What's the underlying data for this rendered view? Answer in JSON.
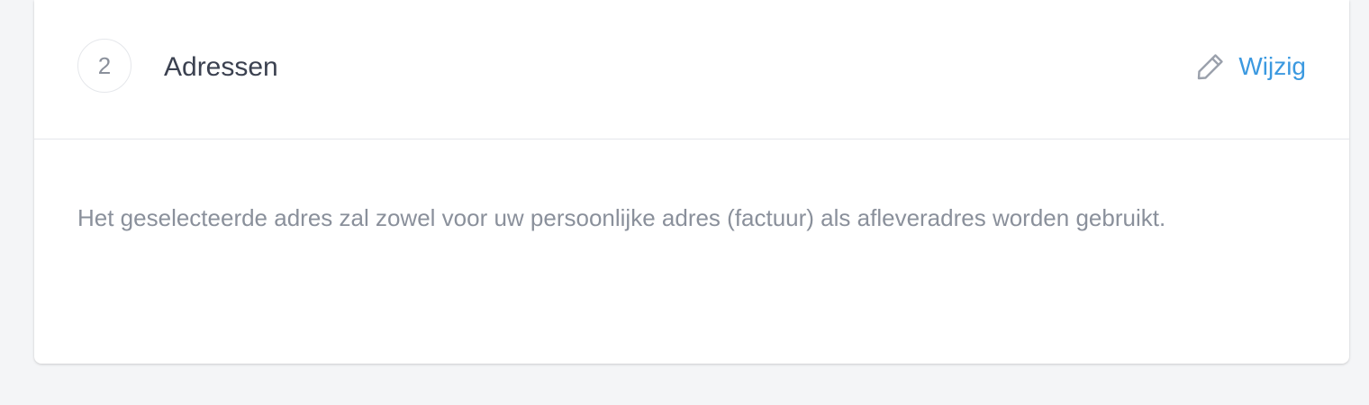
{
  "section": {
    "step_number": "2",
    "title": "Adressen",
    "edit_label": "Wijzig",
    "edit_icon": "pencil-icon",
    "description": "Het geselecteerde adres zal zowel voor uw persoonlijke adres (factuur) als afleveradres worden gebruikt."
  },
  "colors": {
    "accent": "#3b99e0",
    "title_text": "#3b4150",
    "muted_text": "#8a909b",
    "page_background": "#f4f5f7",
    "divider": "#e5e7eb"
  }
}
